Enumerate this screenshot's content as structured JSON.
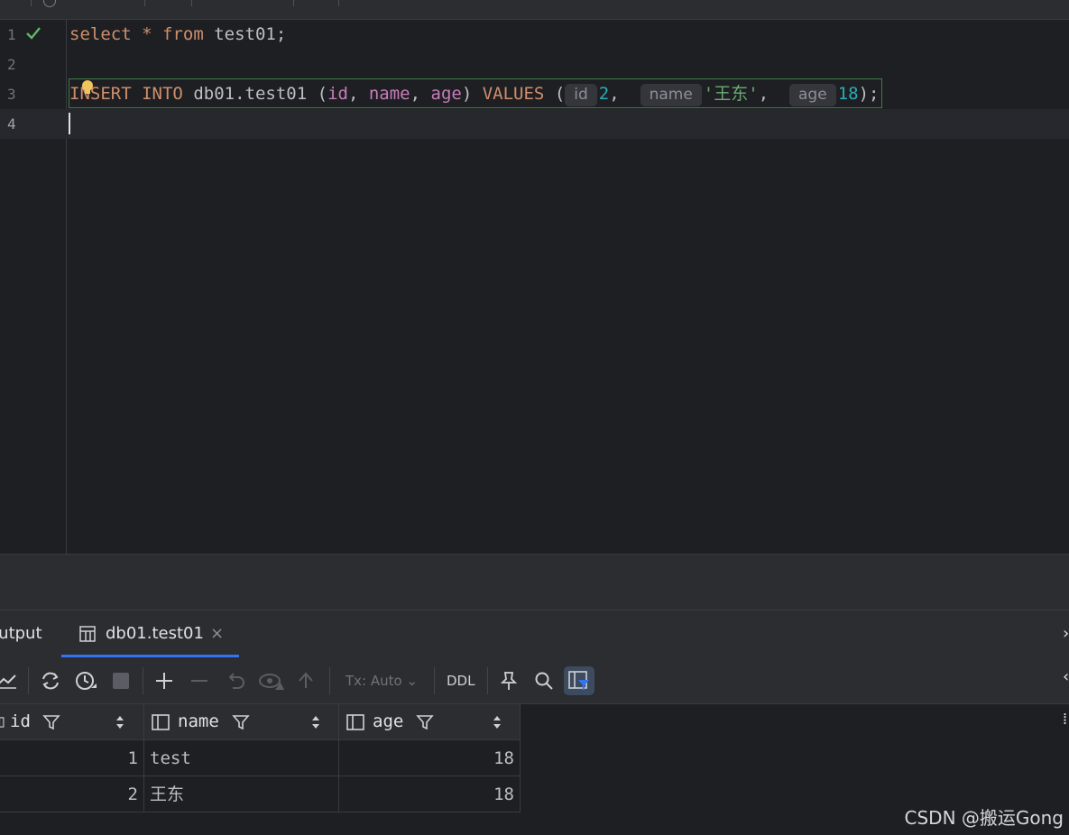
{
  "editor": {
    "lines": [
      {
        "num": "1"
      },
      {
        "num": "2"
      },
      {
        "num": "3"
      },
      {
        "num": "4"
      }
    ],
    "line1": {
      "kw1": "select",
      "star": "*",
      "kw2": "from",
      "table": "test01;"
    },
    "line3": {
      "kw1": "INSERT",
      "kw2": "INTO",
      "table": "db01.test01",
      "open": "(",
      "col1": "id",
      "col2": "name",
      "col3": "age",
      "close": ")",
      "kw3": "VALUES",
      "open2": "(",
      "hint1": "id",
      "val1": "2",
      "hint2": "name",
      "val2": "'王东'",
      "hint3": "age",
      "val3": "18",
      "end": ");"
    }
  },
  "tabs": {
    "output_label": "Output",
    "table_tab_label": "db01.test01",
    "close_glyph": "×"
  },
  "toolbar": {
    "tx_label": "Tx: Auto",
    "ddl_label": "DDL"
  },
  "grid": {
    "columns": [
      "id",
      "name",
      "age"
    ],
    "rows": [
      {
        "id": "1",
        "name": "test",
        "age": "18"
      },
      {
        "id": "2",
        "name": "王东",
        "age": "18"
      }
    ]
  },
  "watermark": "CSDN @搬运Gong",
  "colors": {
    "accent": "#3574f0",
    "keyword": "#cf8e6d",
    "number": "#2aacb8",
    "string": "#6aab73",
    "column": "#c77dbb",
    "check": "#5fb865"
  }
}
